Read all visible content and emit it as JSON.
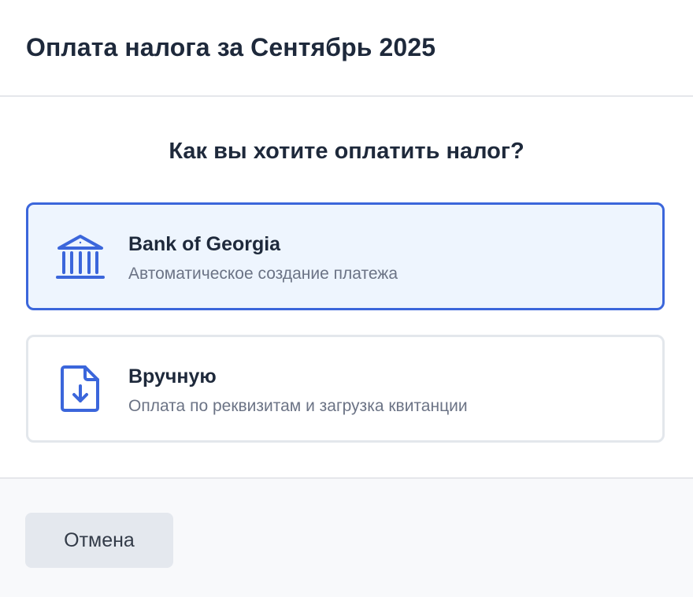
{
  "header": {
    "title": "Оплата налога за Сентябрь 2025"
  },
  "question": "Как вы хотите оплатить налог?",
  "options": [
    {
      "title": "Bank of Georgia",
      "subtitle": "Автоматическое создание платежа",
      "icon": "bank-icon",
      "selected": true
    },
    {
      "title": "Вручную",
      "subtitle": "Оплата по реквизитам и загрузка квитанции",
      "icon": "document-download-icon",
      "selected": false
    }
  ],
  "footer": {
    "cancel_label": "Отмена"
  },
  "colors": {
    "accent": "#3b66db",
    "selected_background": "#eef5fe",
    "text_primary": "#1e293b",
    "text_secondary": "#6b7385",
    "footer_background": "#f8f9fb",
    "button_background": "#e4e8ee"
  }
}
